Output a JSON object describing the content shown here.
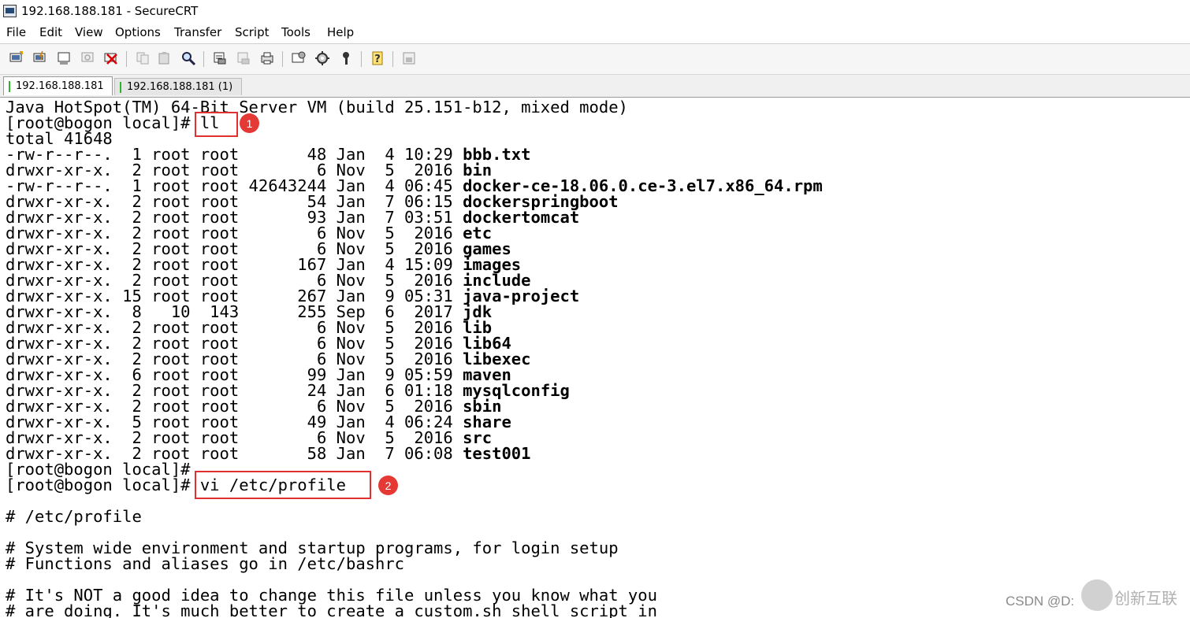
{
  "window": {
    "title": "192.168.188.181 - SecureCRT"
  },
  "menu": [
    "File",
    "Edit",
    "View",
    "Options",
    "Transfer",
    "Script",
    "Tools",
    "Help"
  ],
  "toolbar": {
    "icons": [
      "connect-icon",
      "quick-connect-icon",
      "connect-tab-icon",
      "reconnect-icon",
      "disconnect-icon",
      "copy-icon",
      "paste-icon",
      "find-icon",
      "print-icon",
      "print-selection-icon",
      "print-setup-icon",
      "session-options-icon",
      "global-options-icon",
      "keymap-icon",
      "help-icon",
      "sftp-icon"
    ]
  },
  "tabs": [
    {
      "label": "192.168.188.181",
      "active": true
    },
    {
      "label": "192.168.188.181 (1)",
      "active": false
    }
  ],
  "terminal": {
    "java_line": "Java HotSpot(TM) 64-Bit Server VM (build 25.151-b12, mixed mode)",
    "prompt": "[root@bogon local]#",
    "cmd1": "ll",
    "total": "total 41648",
    "listing": [
      {
        "meta": "-rw-r--r--.  1 root root       48 Jan  4 10:29",
        "name": "bbb.txt"
      },
      {
        "meta": "drwxr-xr-x.  2 root root        6 Nov  5  2016",
        "name": "bin"
      },
      {
        "meta": "-rw-r--r--.  1 root root 42643244 Jan  4 06:45",
        "name": "docker-ce-18.06.0.ce-3.el7.x86_64.rpm"
      },
      {
        "meta": "drwxr-xr-x.  2 root root       54 Jan  7 06:15",
        "name": "dockerspringboot"
      },
      {
        "meta": "drwxr-xr-x.  2 root root       93 Jan  7 03:51",
        "name": "dockertomcat"
      },
      {
        "meta": "drwxr-xr-x.  2 root root        6 Nov  5  2016",
        "name": "etc"
      },
      {
        "meta": "drwxr-xr-x.  2 root root        6 Nov  5  2016",
        "name": "games"
      },
      {
        "meta": "drwxr-xr-x.  2 root root      167 Jan  4 15:09",
        "name": "images"
      },
      {
        "meta": "drwxr-xr-x.  2 root root        6 Nov  5  2016",
        "name": "include"
      },
      {
        "meta": "drwxr-xr-x. 15 root root      267 Jan  9 05:31",
        "name": "java-project"
      },
      {
        "meta": "drwxr-xr-x.  8   10  143      255 Sep  6  2017",
        "name": "jdk"
      },
      {
        "meta": "drwxr-xr-x.  2 root root        6 Nov  5  2016",
        "name": "lib"
      },
      {
        "meta": "drwxr-xr-x.  2 root root        6 Nov  5  2016",
        "name": "lib64"
      },
      {
        "meta": "drwxr-xr-x.  2 root root        6 Nov  5  2016",
        "name": "libexec"
      },
      {
        "meta": "drwxr-xr-x.  6 root root       99 Jan  9 05:59",
        "name": "maven"
      },
      {
        "meta": "drwxr-xr-x.  2 root root       24 Jan  6 01:18",
        "name": "mysqlconfig"
      },
      {
        "meta": "drwxr-xr-x.  2 root root        6 Nov  5  2016",
        "name": "sbin"
      },
      {
        "meta": "drwxr-xr-x.  5 root root       49 Jan  4 06:24",
        "name": "share"
      },
      {
        "meta": "drwxr-xr-x.  2 root root        6 Nov  5  2016",
        "name": "src"
      },
      {
        "meta": "drwxr-xr-x.  2 root root       58 Jan  7 06:08",
        "name": "test001"
      }
    ],
    "cmd2": "vi /etc/profile",
    "vi_lines": [
      "# /etc/profile",
      "",
      "# System wide environment and startup programs, for login setup",
      "# Functions and aliases go in /etc/bashrc",
      "",
      "# It's NOT a good idea to change this file unless you know what you",
      "# are doing. It's much better to create a custom.sh shell script in"
    ]
  },
  "annotations": {
    "badge1": "1",
    "badge2": "2"
  },
  "watermark": {
    "csdn": "CSDN @D:",
    "brand": "创新互联"
  },
  "colors": {
    "highlight": "#e03030",
    "badge": "#e53935",
    "tab_indicator": "#2bb52b"
  }
}
